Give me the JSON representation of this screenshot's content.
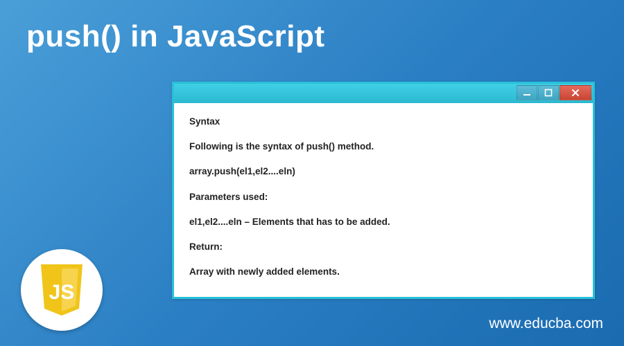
{
  "title": "push() in JavaScript",
  "window": {
    "lines": [
      "Syntax",
      "Following is the syntax of push() method.",
      "array.push(el1,el2....eln)",
      "Parameters used:",
      "el1,el2....eln – Elements that has to be added.",
      "Return:",
      "Array with newly added elements."
    ]
  },
  "logo": {
    "text": "JS"
  },
  "footer": "www.educba.com"
}
